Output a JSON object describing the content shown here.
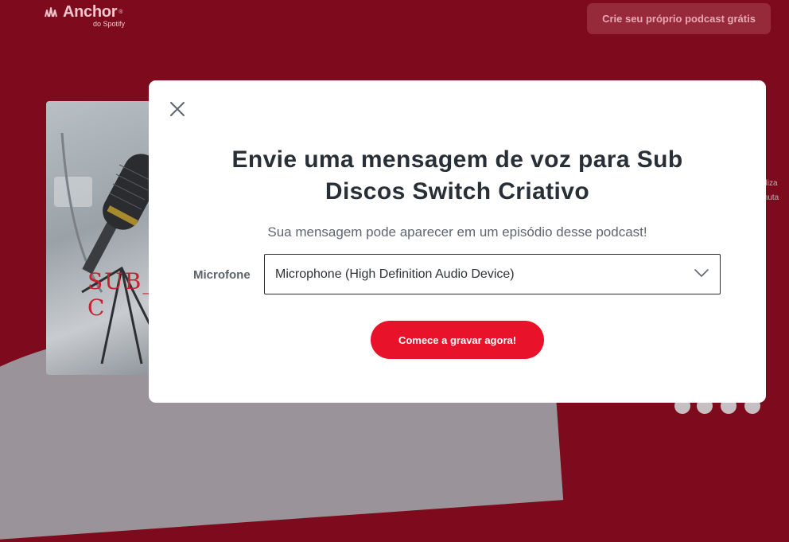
{
  "header": {
    "logo_name": "Anchor",
    "logo_reg": "®",
    "logo_sub": "do Spotify",
    "cta_label": "Crie seu próprio podcast grátis"
  },
  "background": {
    "side_text": [
      "aliza",
      "muta"
    ],
    "cover_text": "SUB_D C"
  },
  "modal": {
    "close_icon": "close-x-icon",
    "title": "Envie uma mensagem de voz para Sub Discos Switch Criativo",
    "subtitle": "Sua mensagem pode aparecer em um episódio desse podcast!",
    "microphone_label": "Microfone",
    "microphone_value": "Microphone (High Definition Audio Device)",
    "record_button": "Comece a gravar agora!"
  },
  "colors": {
    "page_bg": "#7d0b1d",
    "accent": "#e8122b",
    "modal_bg": "#ffffff",
    "title_text": "#292f36"
  }
}
